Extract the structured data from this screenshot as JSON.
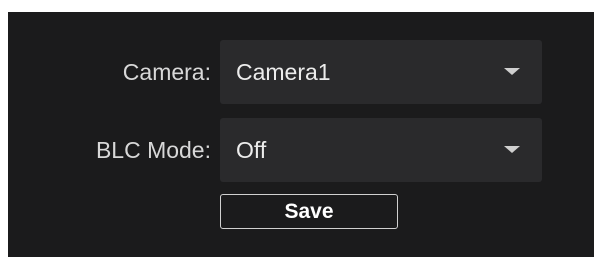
{
  "form": {
    "camera": {
      "label": "Camera:",
      "value": "Camera1"
    },
    "blc_mode": {
      "label": "BLC Mode:",
      "value": "Off"
    },
    "save_label": "Save"
  },
  "icons": {
    "dropdown": "chevron-down-icon"
  },
  "colors": {
    "panel_background": "#1b1b1c",
    "field_background": "#2a2a2c",
    "text": "#ececec",
    "button_border": "#d0d0d0"
  }
}
